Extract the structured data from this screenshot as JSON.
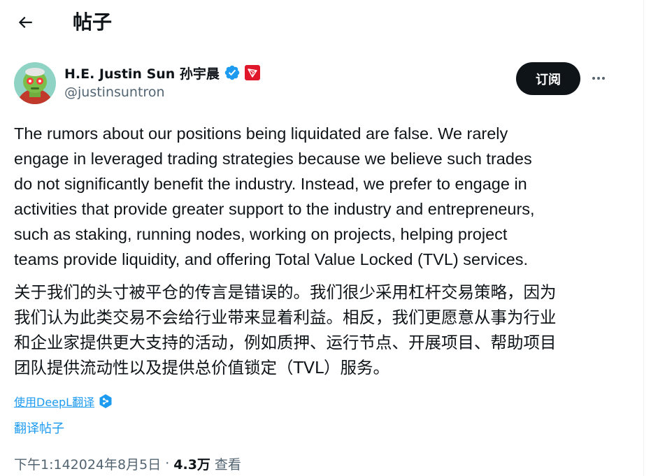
{
  "header": {
    "title": "帖子",
    "back_icon": "arrow-left-icon"
  },
  "author": {
    "name": "H.E. Justin Sun 孙宇晨",
    "handle": "@justinsuntron",
    "verified_icon": "verified-badge-icon",
    "affiliate_icon": "tron-logo-icon",
    "avatar": "avatar"
  },
  "actions": {
    "subscribe_label": "订阅",
    "more_icon": "more-options-icon"
  },
  "tweet": {
    "text_en": "The rumors about our positions being liquidated are false. We rarely\nengage in leveraged trading strategies because we believe such trades\ndo not significantly benefit the industry. Instead, we prefer to engage in\nactivities that provide greater support to the industry and entrepreneurs,\nsuch as staking, running nodes, working on projects, helping project\nteams provide liquidity, and offering Total Value Locked (TVL) services.",
    "text_zh": "关于我们的头寸被平仓的传言是错误的。我们很少采用杠杆交易策略，因为\n我们认为此类交易不会给行业带来显着利益。相反，我们更愿意从事为行业\n和企业家提供更大支持的活动，例如质押、运行节点、开展项目、帮助项目\n团队提供流动性以及提供总价值锁定（TVL）服务。",
    "deepl_label": "使用DeepL翻译",
    "translate_label": "翻译帖子",
    "time": "下午1:14",
    "date": "2024年8月5日",
    "separator": "·",
    "views_count": "4.3万",
    "views_label": "查看"
  },
  "colors": {
    "text_primary": "#0f1419",
    "text_secondary": "#536471",
    "link": "#1d9bf0",
    "verified": "#1d9bf0",
    "tron_red": "#e0162b"
  }
}
